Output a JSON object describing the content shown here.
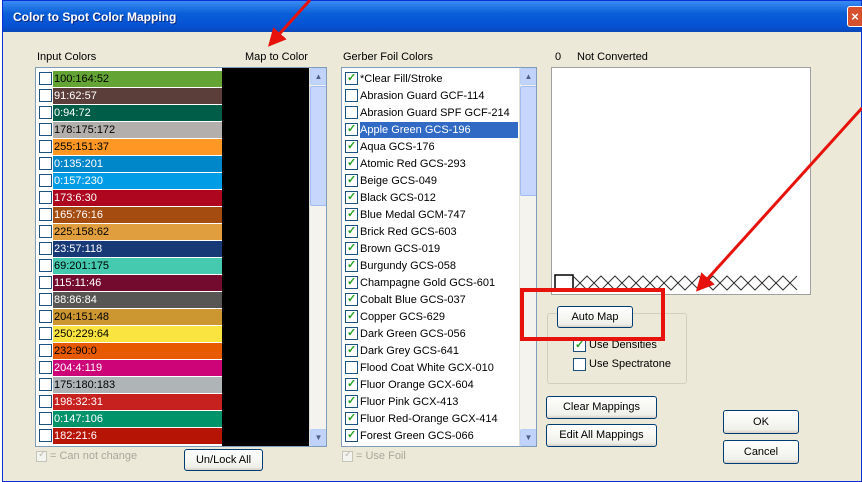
{
  "window": {
    "title": "Color to Spot Color Mapping",
    "close_glyph": "×"
  },
  "input_colors": {
    "header": "Input Colors",
    "map_to_color_header": "Map to Color",
    "items": [
      {
        "label": "100:164:52",
        "color": "#64a434",
        "text": "#000"
      },
      {
        "label": "91:62:57",
        "color": "#5b3e39",
        "text": "#fff"
      },
      {
        "label": "0:94:72",
        "color": "#005e48",
        "text": "#fff"
      },
      {
        "label": "178:175:172",
        "color": "#b2afac",
        "text": "#000"
      },
      {
        "label": "255:151:37",
        "color": "#ff9725",
        "text": "#000"
      },
      {
        "label": "0:135:201",
        "color": "#0087c9",
        "text": "#fff"
      },
      {
        "label": "0:157:230",
        "color": "#009de6",
        "text": "#fff"
      },
      {
        "label": "173:6:30",
        "color": "#ad061e",
        "text": "#fff"
      },
      {
        "label": "165:76:16",
        "color": "#a54c10",
        "text": "#fff"
      },
      {
        "label": "225:158:62",
        "color": "#e19e3e",
        "text": "#000"
      },
      {
        "label": "23:57:118",
        "color": "#173976",
        "text": "#fff"
      },
      {
        "label": "69:201:175",
        "color": "#45c9af",
        "text": "#000"
      },
      {
        "label": "115:11:46",
        "color": "#730b2e",
        "text": "#fff"
      },
      {
        "label": "88:86:84",
        "color": "#585654",
        "text": "#fff"
      },
      {
        "label": "204:151:48",
        "color": "#cc9730",
        "text": "#000"
      },
      {
        "label": "250:229:64",
        "color": "#fae540",
        "text": "#000"
      },
      {
        "label": "232:90:0",
        "color": "#e85a00",
        "text": "#000"
      },
      {
        "label": "204:4:119",
        "color": "#cc0477",
        "text": "#fff"
      },
      {
        "label": "175:180:183",
        "color": "#afb4b7",
        "text": "#000"
      },
      {
        "label": "198:32:31",
        "color": "#c6201f",
        "text": "#fff"
      },
      {
        "label": "0:147:106",
        "color": "#00936a",
        "text": "#fff"
      },
      {
        "label": "182:21:6",
        "color": "#b61506",
        "text": "#fff"
      }
    ],
    "cannot_change_legend": "= Can not change",
    "unlock_all": "Un/Lock All"
  },
  "foil_colors": {
    "header": "Gerber Foil Colors",
    "items": [
      {
        "label": "*Clear Fill/Stroke",
        "checked": true,
        "selected": false
      },
      {
        "label": "Abrasion Guard GCF-114",
        "checked": false,
        "selected": false
      },
      {
        "label": "Abrasion Guard SPF GCF-214",
        "checked": false,
        "selected": false
      },
      {
        "label": "Apple Green GCS-196",
        "checked": true,
        "selected": true
      },
      {
        "label": "Aqua GCS-176",
        "checked": true,
        "selected": false
      },
      {
        "label": "Atomic Red GCS-293",
        "checked": true,
        "selected": false
      },
      {
        "label": "Beige GCS-049",
        "checked": true,
        "selected": false
      },
      {
        "label": "Black GCS-012",
        "checked": true,
        "selected": false
      },
      {
        "label": "Blue Medal GCM-747",
        "checked": true,
        "selected": false
      },
      {
        "label": "Brick Red GCS-603",
        "checked": true,
        "selected": false
      },
      {
        "label": "Brown GCS-019",
        "checked": true,
        "selected": false
      },
      {
        "label": "Burgundy GCS-058",
        "checked": true,
        "selected": false
      },
      {
        "label": "Champagne Gold GCS-601",
        "checked": true,
        "selected": false
      },
      {
        "label": "Cobalt Blue GCS-037",
        "checked": true,
        "selected": false
      },
      {
        "label": "Copper GCS-629",
        "checked": true,
        "selected": false
      },
      {
        "label": "Dark Green GCS-056",
        "checked": true,
        "selected": false
      },
      {
        "label": "Dark Grey GCS-641",
        "checked": true,
        "selected": false
      },
      {
        "label": "Flood Coat White GCX-010",
        "checked": false,
        "selected": false
      },
      {
        "label": "Fluor Orange GCX-604",
        "checked": true,
        "selected": false
      },
      {
        "label": "Fluor Pink GCX-413",
        "checked": true,
        "selected": false
      },
      {
        "label": "Fluor Red-Orange GCX-414",
        "checked": true,
        "selected": false
      },
      {
        "label": "Forest Green GCS-066",
        "checked": true,
        "selected": false
      }
    ],
    "use_foil_legend": "= Use Foil"
  },
  "preview": {
    "count": "0",
    "status": "Not Converted"
  },
  "auto_map": {
    "button": "Auto Map",
    "use_densities": {
      "label": "Use Densities",
      "checked": true
    },
    "use_spectratone": {
      "label": "Use Spectratone",
      "checked": false
    }
  },
  "buttons": {
    "clear_mappings": "Clear Mappings",
    "edit_all_mappings": "Edit All Mappings",
    "ok": "OK",
    "cancel": "Cancel"
  },
  "colors": {
    "selection": "#316ac5",
    "annotation_red": "#e8120c",
    "title_bar": "#0552d4"
  }
}
